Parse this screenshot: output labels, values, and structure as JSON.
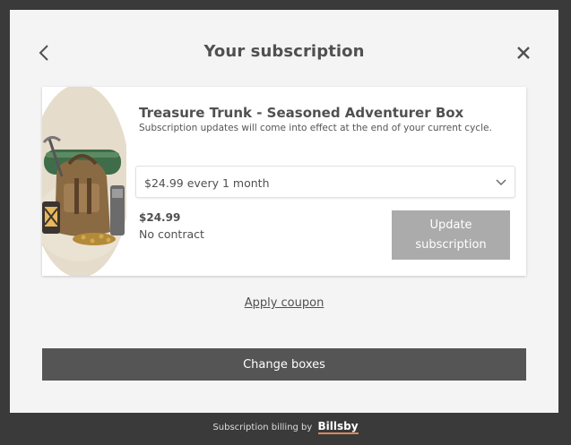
{
  "header": {
    "title": "Your subscription"
  },
  "icons": {
    "back": "chevron-left-icon",
    "close": "close-icon",
    "dropdown": "chevron-down-icon"
  },
  "product": {
    "name": "Treasure Trunk - Seasoned Adventurer Box",
    "notice": "Subscription updates will come into effect at the end of your current cycle.",
    "selected_cycle": "$24.99 every 1 month",
    "price": "$24.99",
    "contract": "No contract",
    "update_button_label": "Update subscription"
  },
  "coupon_label": "Apply coupon",
  "change_boxes_label": "Change boxes",
  "footer": {
    "text": "Subscription billing by",
    "brand": "Billsby"
  },
  "colors": {
    "overlay": "#3a3a3a",
    "modal_bg": "#f4f4f4",
    "primary_button": "#555555",
    "disabled_button": "#ababab",
    "brand_underline": "#d98a5a"
  }
}
